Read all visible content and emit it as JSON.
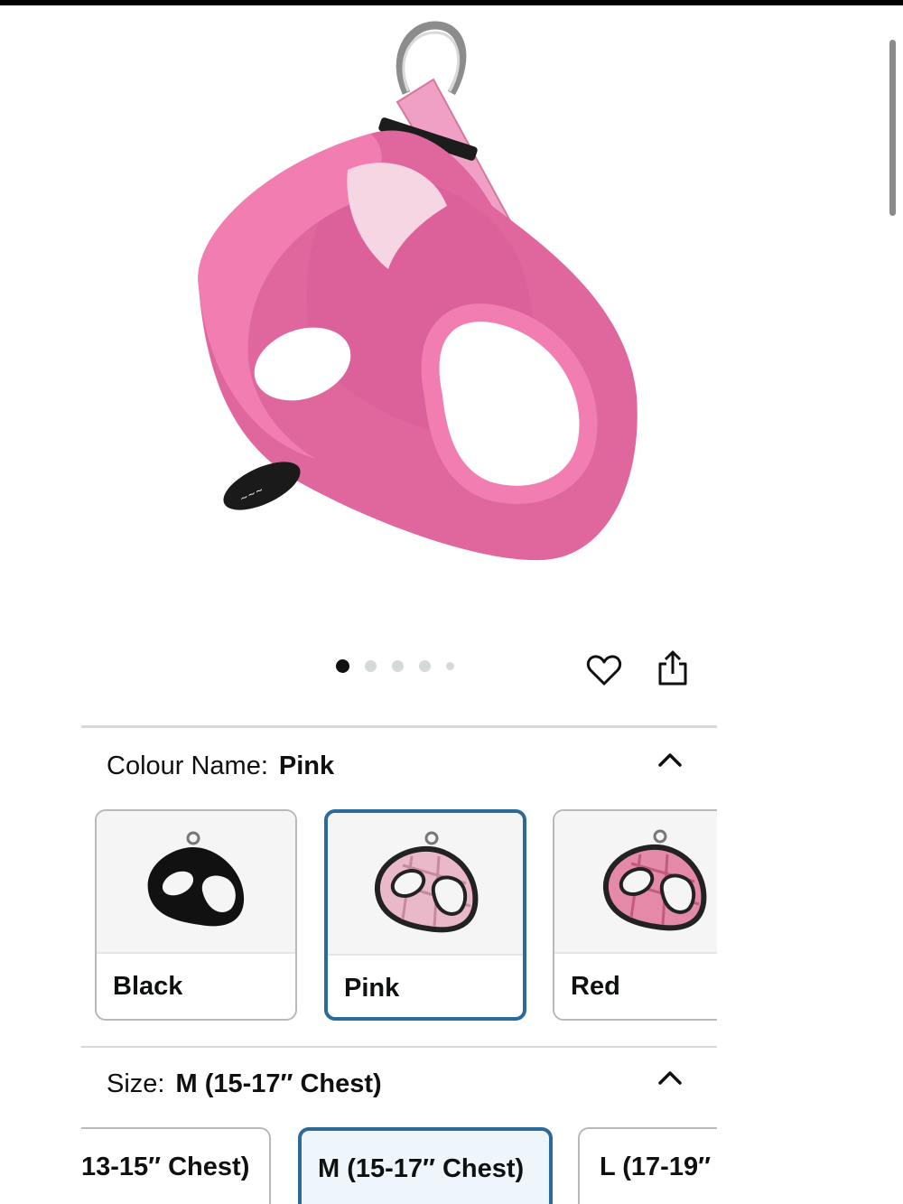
{
  "product": {
    "image_alt": "pink mesh dog harness",
    "carousel": {
      "total_images": 5,
      "current_index": 1
    }
  },
  "actions": {
    "wishlist_icon": "heart-outline-icon",
    "share_icon": "share-icon"
  },
  "colour": {
    "label": "Colour Name:",
    "selected": "Pink",
    "expanded_icon": "chevron-up-icon",
    "options": [
      {
        "name": "Black",
        "selected": false
      },
      {
        "name": "Pink",
        "selected": true
      },
      {
        "name": "Red",
        "selected": false
      }
    ]
  },
  "size": {
    "label": "Size:",
    "selected": "M (15-17″ Chest)",
    "expanded_icon": "chevron-up-icon",
    "options": [
      {
        "name": "13-15″ Chest)",
        "selected": false
      },
      {
        "name": "M (15-17″ Chest)",
        "selected": true
      },
      {
        "name": "L (17-19″",
        "selected": false
      }
    ]
  },
  "colors": {
    "selected_border": "#2e6a99",
    "harness_pink": "#e0669e",
    "text": "#0f1111"
  }
}
